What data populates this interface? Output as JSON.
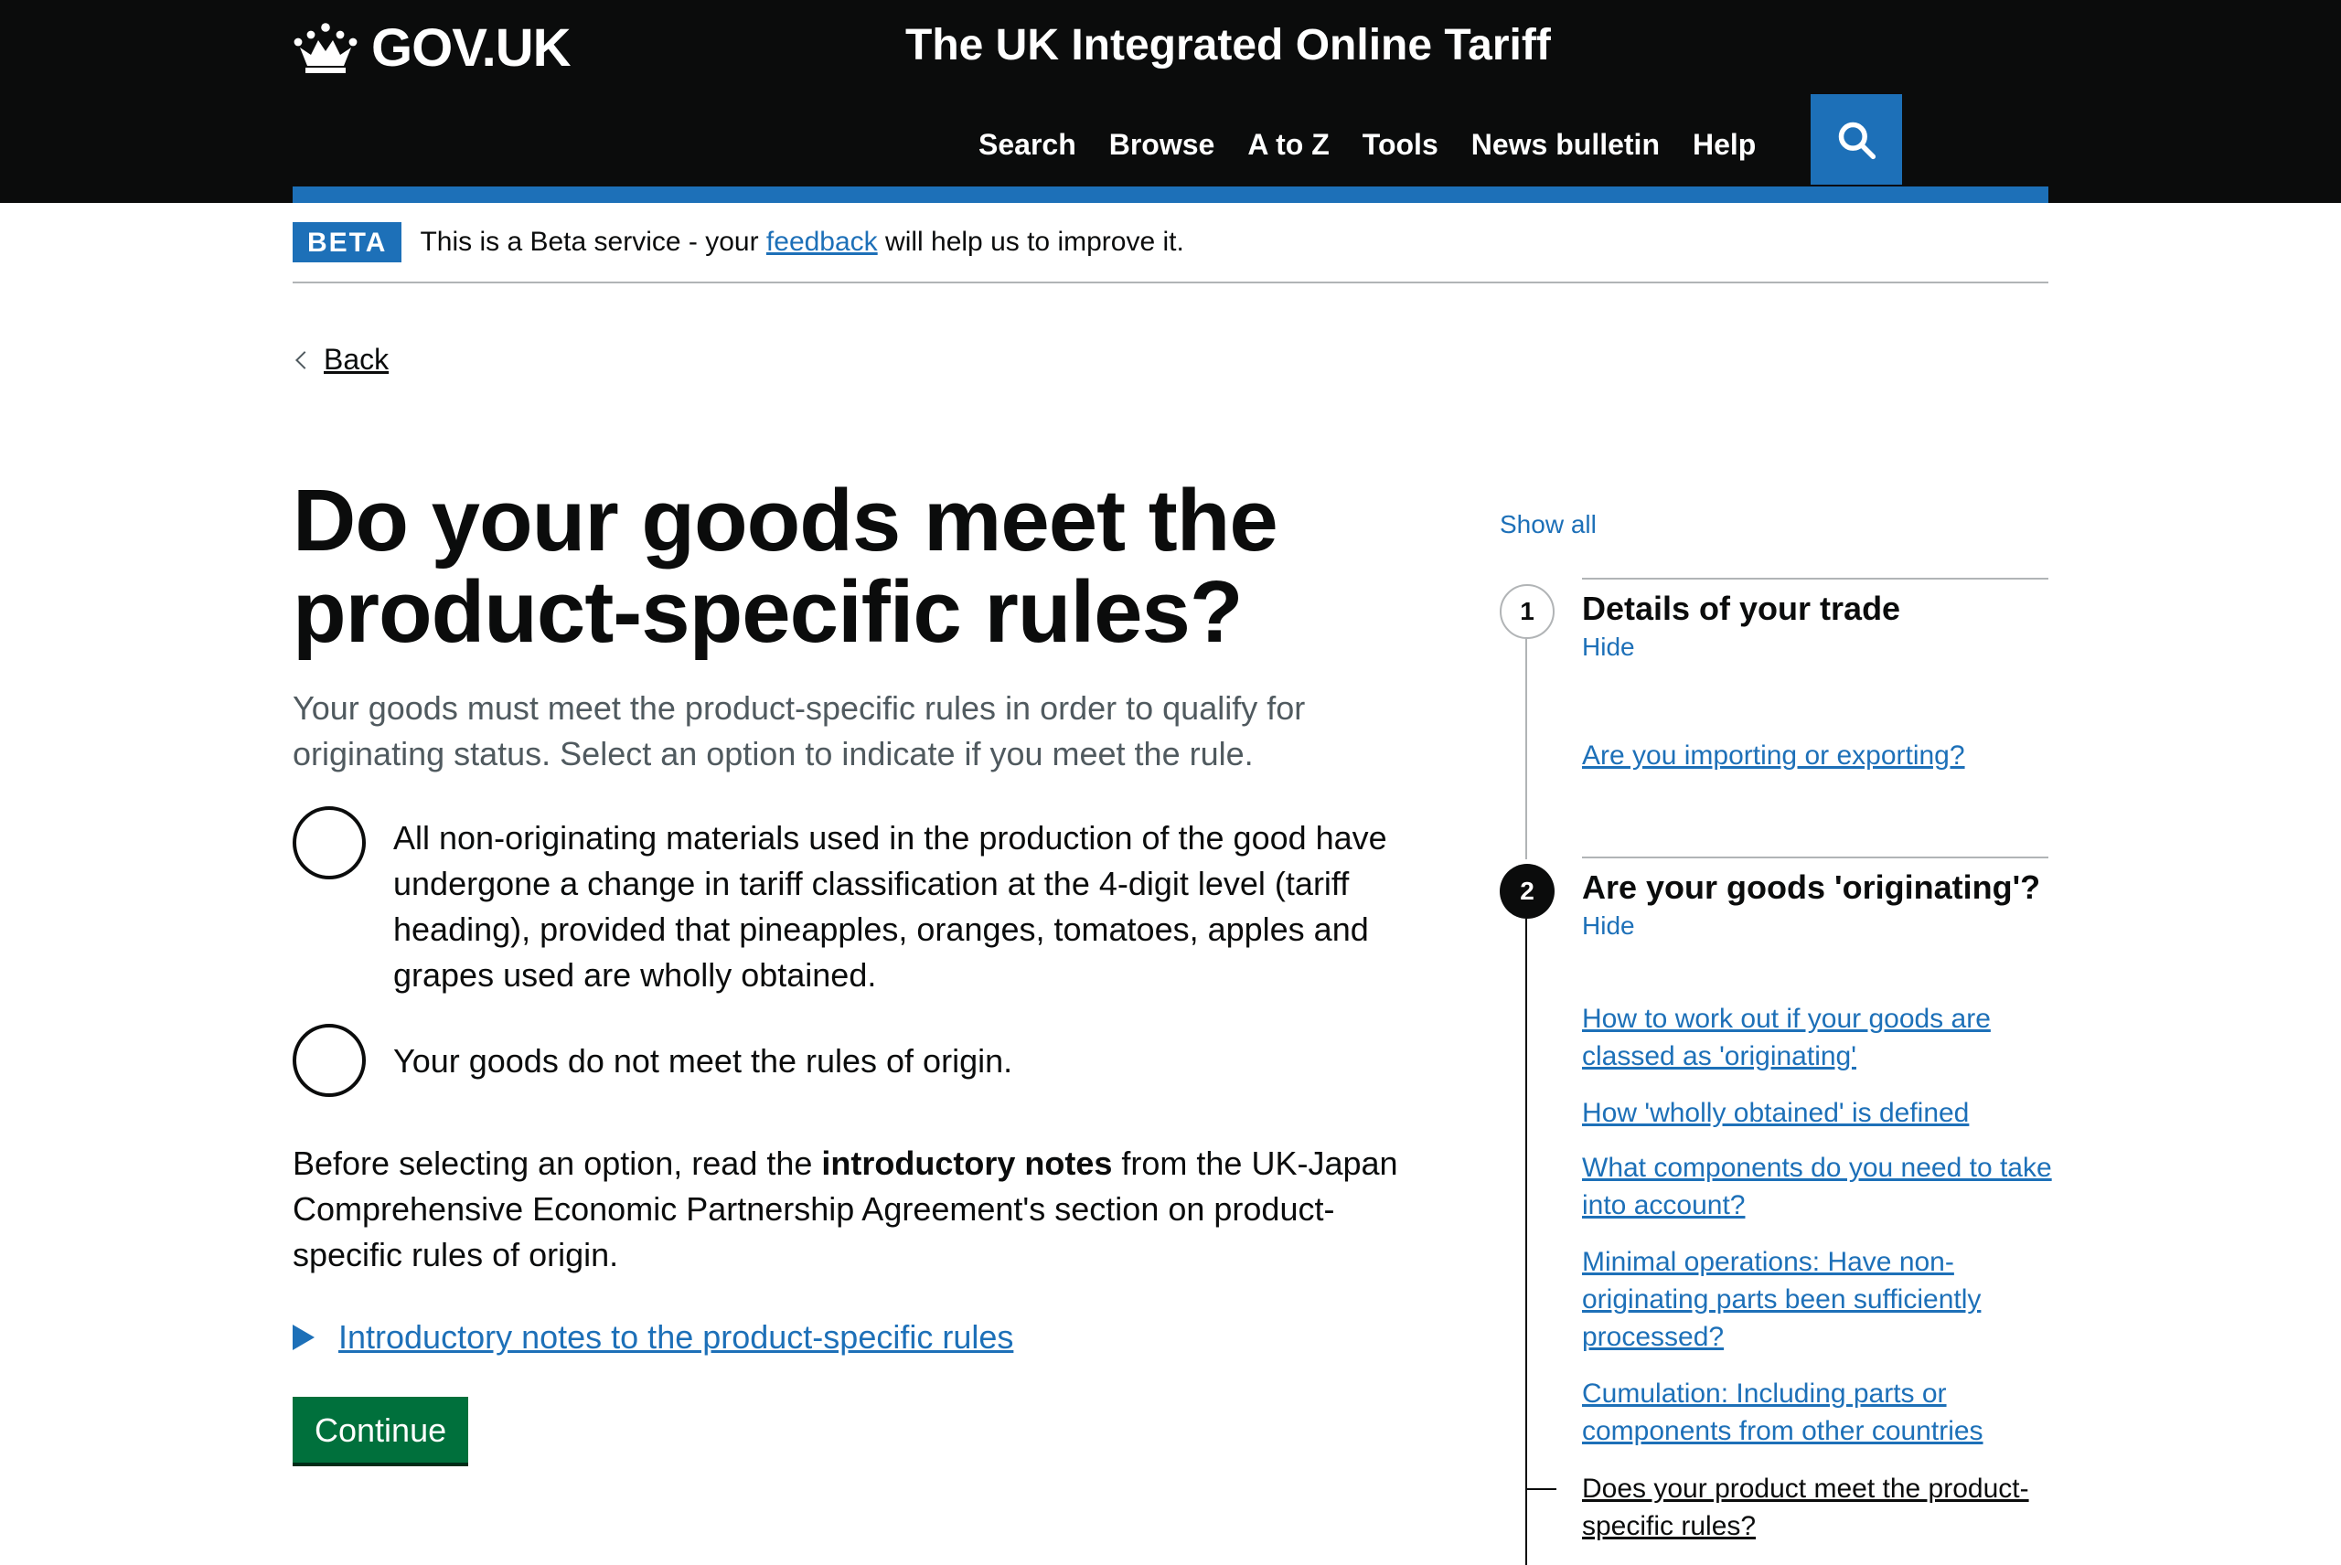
{
  "header": {
    "logo_text": "GOV.UK",
    "service_name": "The UK Integrated Online Tariff",
    "nav": [
      "Search",
      "Browse",
      "A to Z",
      "Tools",
      "News bulletin",
      "Help"
    ],
    "search_icon": "search-icon"
  },
  "phase_banner": {
    "tag": "BETA",
    "text_before": "This is a Beta service - your ",
    "link": "feedback",
    "text_after": " will help us to improve it."
  },
  "back": "Back",
  "main": {
    "title": "Do your goods meet the product-specific rules?",
    "hint": "Your goods must meet the product-specific rules in order to qualify for originating status. Select an option to indicate if you meet the rule.",
    "options": [
      "All non-originating materials used in the production of the good have undergone a change in tariff classification at the 4-digit level (tariff heading), provided that pineapples, oranges, tomatoes, apples and grapes used are wholly obtained.",
      "Your goods do not meet the rules of origin."
    ],
    "para_before": "Before selecting an option, read the ",
    "para_bold": "introductory notes",
    "para_after": " from the UK-Japan Comprehensive Economic Partnership Agreement's section on product-specific rules of origin.",
    "details_summary": "Introductory notes to the product-specific rules",
    "continue": "Continue"
  },
  "step_nav": {
    "show_all": "Show all",
    "steps": [
      {
        "number": "1",
        "title": "Details of your trade",
        "toggle": "Hide",
        "links": [
          "Are you importing or exporting?"
        ]
      },
      {
        "number": "2",
        "title": "Are your goods 'originating'?",
        "toggle": "Hide",
        "links": [
          "How to work out if your goods are classed as 'originating'",
          "How 'wholly obtained' is defined",
          "What components do you need to take into account?",
          "Minimal operations: Have non-originating parts been sufficiently processed?",
          "Cumulation: Including parts or components from other countries",
          "Does your product meet the product-specific rules?"
        ]
      }
    ]
  },
  "colors": {
    "header_bg": "#0b0c0c",
    "brand_blue": "#1d70b8",
    "button_green": "#00703c",
    "secondary_text": "#505a5f"
  }
}
